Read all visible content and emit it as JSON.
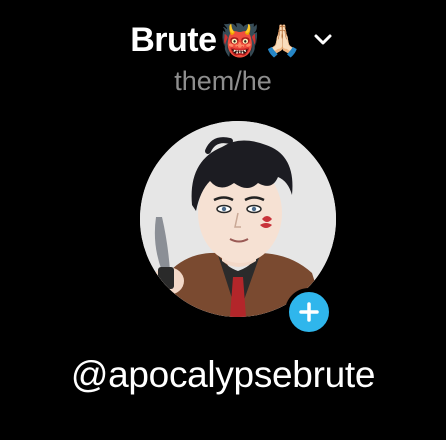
{
  "profile": {
    "display_name": "Brute",
    "emoji_1": "👹",
    "emoji_2": "🙏🏻",
    "pronouns": "them/he",
    "username": "@apocalypsebrute"
  },
  "icons": {
    "switch_account": "chevron-down-icon",
    "follow": "plus-icon"
  },
  "colors": {
    "background": "#000000",
    "pronouns_text": "#8e8e8e",
    "follow_button": "#2fb6ec"
  }
}
